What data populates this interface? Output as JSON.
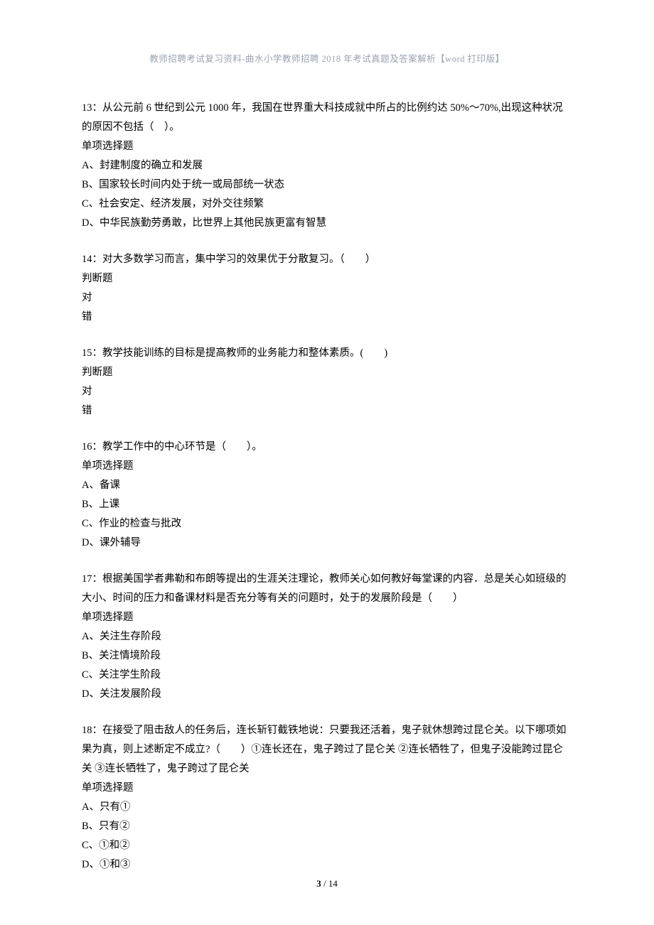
{
  "header": {
    "title": "教师招聘考试复习资料-曲水小学教师招聘 2018 年考试真题及答案解析【word 打印版】"
  },
  "questions": [
    {
      "num": "13",
      "stem": "：从公元前 6 世纪到公元 1000 年，我国在世界重大科技成就中所占的比例约达 50%～70%,出现这种状况的原因不包括（　）。",
      "type": "单项选择题",
      "options": [
        "A、封建制度的确立和发展",
        "B、国家较长时间内处于统一或局部统一状态",
        "C、社会安定、经济发展，对外交往频繁",
        "D、中华民族勤劳勇敢，比世界上其他民族更富有智慧"
      ]
    },
    {
      "num": "14",
      "stem": "：对大多数学习而言，集中学习的效果优于分散复习。（　　）",
      "type": "判断题",
      "options": [
        "对",
        "错"
      ]
    },
    {
      "num": "15",
      "stem": "：教学技能训练的目标是提高教师的业务能力和整体素质。(　　)",
      "type": "判断题",
      "options": [
        "对",
        "错"
      ]
    },
    {
      "num": "16",
      "stem": "：教学工作中的中心环节是（　　）。",
      "type": "单项选择题",
      "options": [
        "A、备课",
        "B、上课",
        "C、作业的检查与批改",
        "D、课外辅导"
      ]
    },
    {
      "num": "17",
      "stem": "：根据美国学者弗勒和布朗等提出的生涯关注理论，教师关心如何教好每堂课的内容．总是关心如班级的大小、时间的压力和备课材料是否充分等有关的问题时，处于的发展阶段是（　　）",
      "type": "单项选择题",
      "options": [
        "A、关注生存阶段",
        "B、关注情境阶段",
        "C、关注学生阶段",
        "D、关注发展阶段"
      ]
    },
    {
      "num": "18",
      "stem": "：在接受了阻击敌人的任务后，连长斩钉截铁地说：只要我还活着，鬼子就休想跨过昆仑关。以下哪项如果为真，则上述断定不成立?（　　）①连长还在，鬼子跨过了昆仑关 ②连长牺牲了，但鬼子没能跨过昆仑关 ③连长牺牲了，鬼子跨过了昆仑关",
      "type": "单项选择题",
      "options": [
        "A、只有①",
        "B、只有②",
        "C、①和②",
        "D、①和③"
      ]
    }
  ],
  "footer": {
    "current": "3",
    "sep": " / ",
    "total": "14"
  }
}
